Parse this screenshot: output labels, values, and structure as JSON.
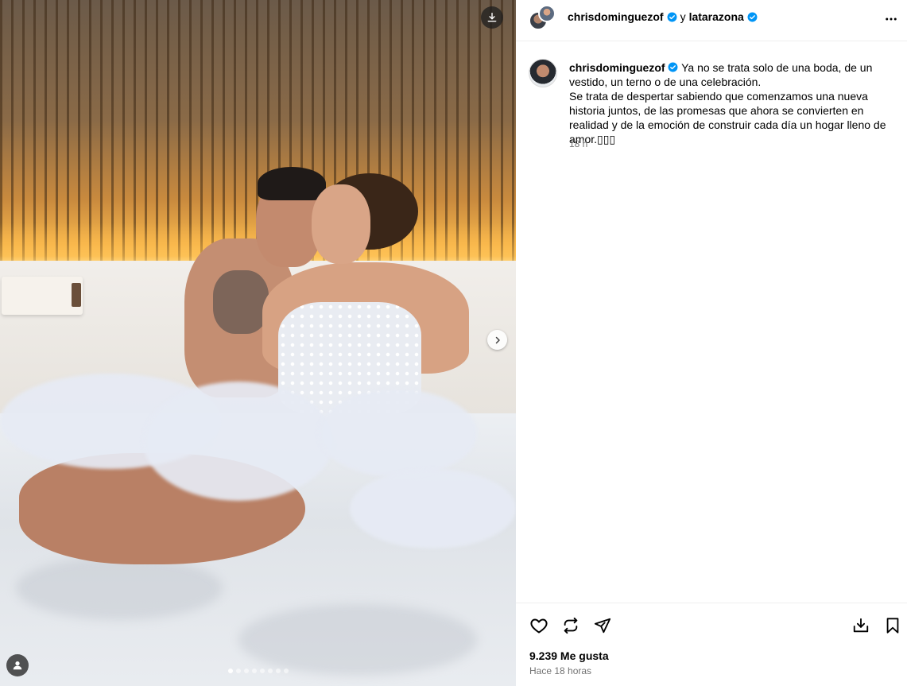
{
  "post": {
    "media": {
      "carousel_count": 8,
      "active_index": 0,
      "icons": {
        "download": "download-icon",
        "next": "chevron-right-icon",
        "tagged": "user-tag-icon"
      }
    },
    "header": {
      "author": "chrisdominguezof",
      "connector": "y",
      "collaborator": "latarazona",
      "verified_color": "#0095f6",
      "more_icon": "more-horizontal-icon"
    },
    "caption": {
      "username": "chrisdominguezof",
      "line1": "Ya no se trata solo de una boda, de un vestido, un terno o de una celebración.",
      "line2": "Se trata de despertar sabiendo que comenzamos una nueva historia juntos, de las promesas que ahora se convierten en realidad y de la emoción de construir cada día un hogar lleno de amor.▯▯▯",
      "time": "18 h"
    },
    "actions": {
      "icons": [
        "heart-icon",
        "repost-icon",
        "share-icon",
        "download-icon",
        "bookmark-icon"
      ],
      "likes": "9.239 Me gusta",
      "time_ago": "Hace 18 horas"
    }
  }
}
